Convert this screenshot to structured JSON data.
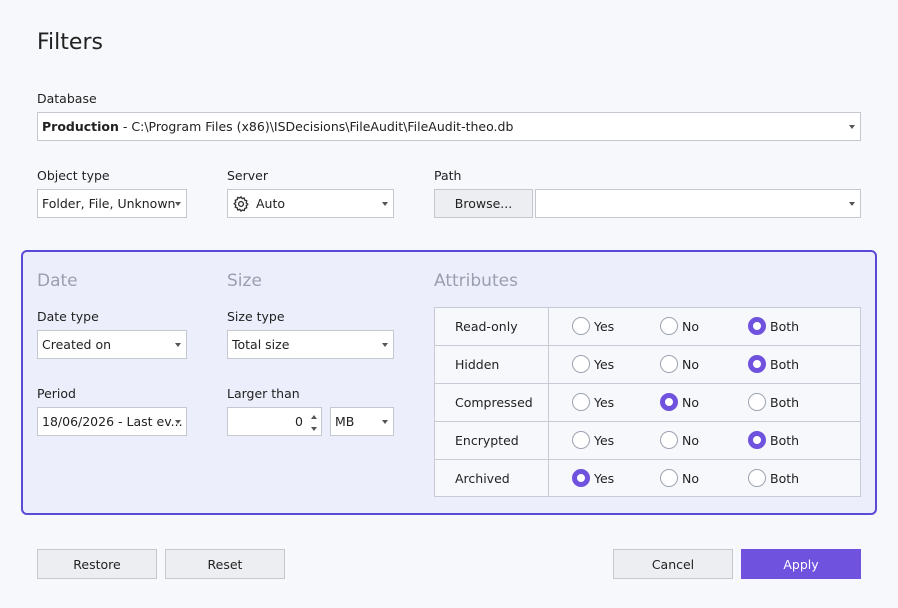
{
  "title": "Filters",
  "database": {
    "label": "Database",
    "name": "Production",
    "path": " - C:\\Program Files (x86)\\ISDecisions\\FileAudit\\FileAudit-theo.db"
  },
  "object_type": {
    "label": "Object type",
    "value": "Folder, File, Unknown"
  },
  "server": {
    "label": "Server",
    "value": "Auto",
    "icon": "gear-icon"
  },
  "path": {
    "label": "Path",
    "browse_label": "Browse...",
    "value": ""
  },
  "date": {
    "heading": "Date",
    "date_type_label": "Date type",
    "date_type_value": "Created on",
    "period_label": "Period",
    "period_value": "18/06/2026 - Last ev..."
  },
  "size": {
    "heading": "Size",
    "size_type_label": "Size type",
    "size_type_value": "Total size",
    "larger_label": "Larger than",
    "larger_value": "0",
    "unit_value": "MB"
  },
  "attributes": {
    "heading": "Attributes",
    "options": [
      "Yes",
      "No",
      "Both"
    ],
    "rows": [
      {
        "name": "Read-only",
        "selected": "Both"
      },
      {
        "name": "Hidden",
        "selected": "Both"
      },
      {
        "name": "Compressed",
        "selected": "No"
      },
      {
        "name": "Encrypted",
        "selected": "Both"
      },
      {
        "name": "Archived",
        "selected": "Yes"
      }
    ]
  },
  "buttons": {
    "restore": "Restore",
    "reset": "Reset",
    "cancel": "Cancel",
    "apply": "Apply"
  },
  "colors": {
    "accent": "#6f52dd",
    "panel_border": "#5a4ad6",
    "panel_bg": "#eceffb"
  }
}
